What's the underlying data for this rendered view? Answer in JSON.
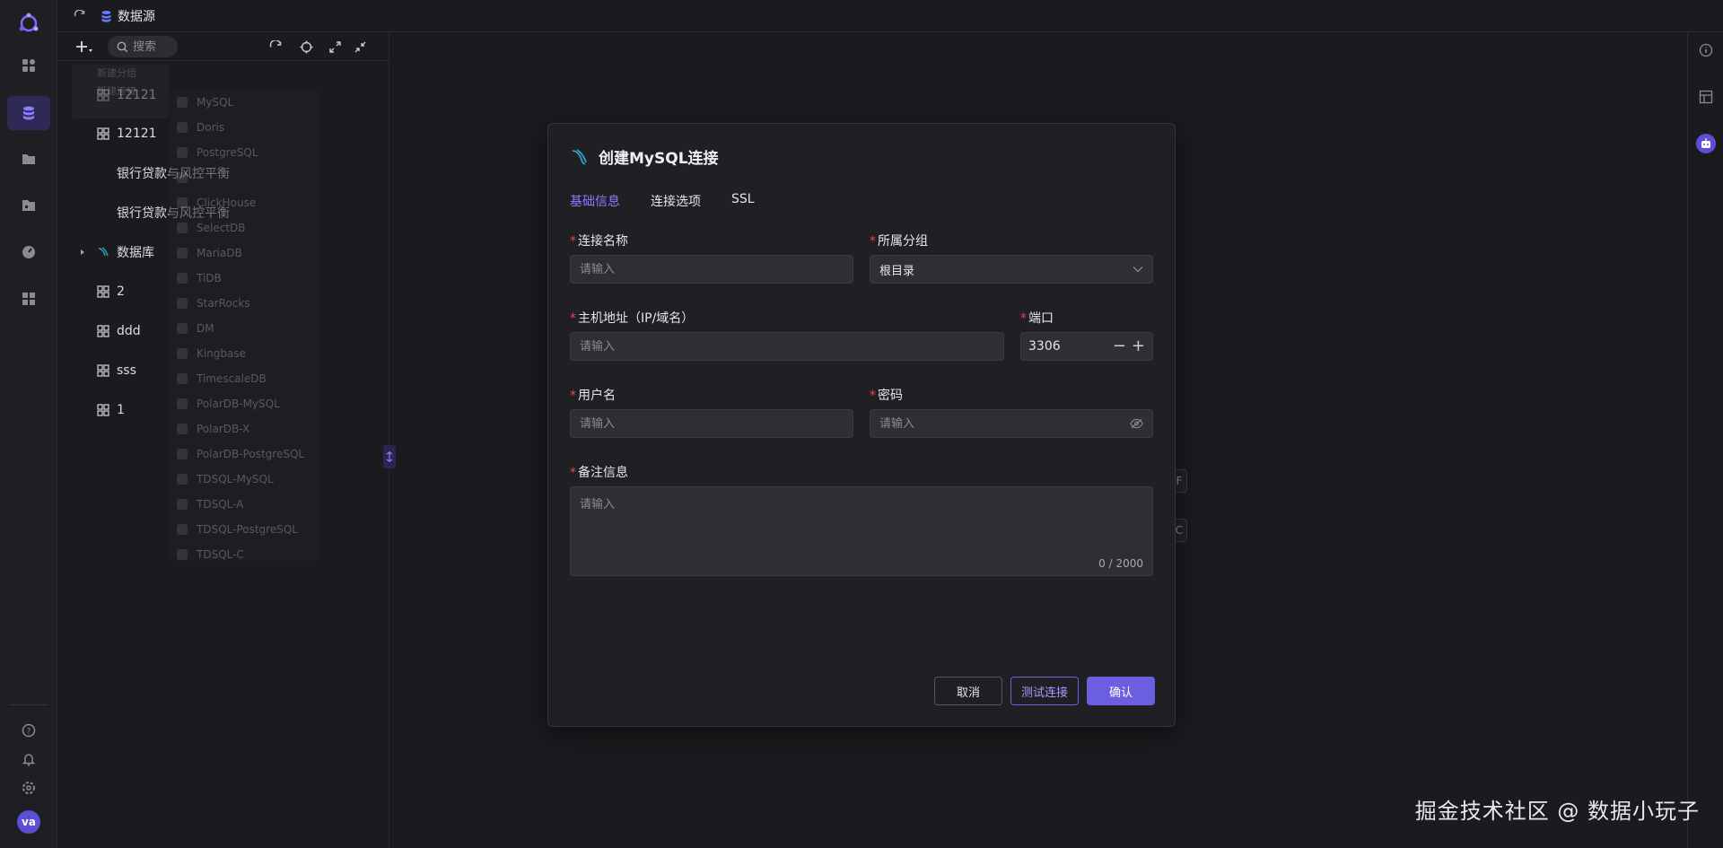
{
  "app": {
    "breadcrumb": "数据源",
    "colors": {
      "accent": "#6b5fe0",
      "required": "#e5484d",
      "background": "#1b1b1f"
    }
  },
  "rail": {
    "icons": [
      "grid-icon",
      "database-icon",
      "folder-icon",
      "file-icon",
      "dashboard-icon",
      "apps-icon"
    ],
    "bottom_icons": [
      "help-icon",
      "bell-icon",
      "settings-icon"
    ],
    "avatar": "va"
  },
  "tree": {
    "search_placeholder": "搜索",
    "nodes": [
      {
        "label": "12121",
        "icon": "group-icon"
      },
      {
        "label": "12121",
        "icon": "group-icon"
      },
      {
        "label": "银行贷款与风控平衡",
        "icon": "none"
      },
      {
        "label": "银行贷款与风控平衡",
        "icon": "none"
      },
      {
        "label": "数据库",
        "icon": "mysql-icon"
      },
      {
        "label": "2",
        "icon": "group-icon"
      },
      {
        "label": "ddd",
        "icon": "group-icon"
      },
      {
        "label": "sss",
        "icon": "group-icon"
      },
      {
        "label": "1",
        "icon": "group-icon"
      }
    ],
    "ghost_menu": [
      "新建分组",
      "新建连接"
    ],
    "ghost_list": [
      "MySQL",
      "Doris",
      "PostgreSQL",
      "",
      "ClickHouse",
      "SelectDB",
      "MariaDB",
      "TiDB",
      "StarRocks",
      "DM",
      "Kingbase",
      "TimescaleDB",
      "PolarDB-MySQL",
      "PolarDB-X",
      "PolarDB-PostgreSQL",
      "TDSQL-MySQL",
      "TDSQL-A",
      "TDSQL-PostgreSQL",
      "TDSQL-C"
    ]
  },
  "background": {
    "key1": "F",
    "key2": "C"
  },
  "modal": {
    "title": "创建MySQL连接",
    "tabs": [
      "基础信息",
      "连接选项",
      "SSL"
    ],
    "fields": {
      "name_label": "连接名称",
      "name_placeholder": "请输入",
      "group_label": "所属分组",
      "group_value": "根目录",
      "host_label": "主机地址（IP/域名）",
      "host_placeholder": "请输入",
      "port_label": "端口",
      "port_value": "3306",
      "user_label": "用户名",
      "user_placeholder": "请输入",
      "password_label": "密码",
      "password_placeholder": "请输入",
      "remark_label": "备注信息",
      "remark_placeholder": "请输入",
      "remark_count": "0 / 2000"
    },
    "buttons": {
      "cancel": "取消",
      "test": "测试连接",
      "ok": "确认"
    }
  },
  "watermark": "掘金技术社区 @ 数据小玩子"
}
